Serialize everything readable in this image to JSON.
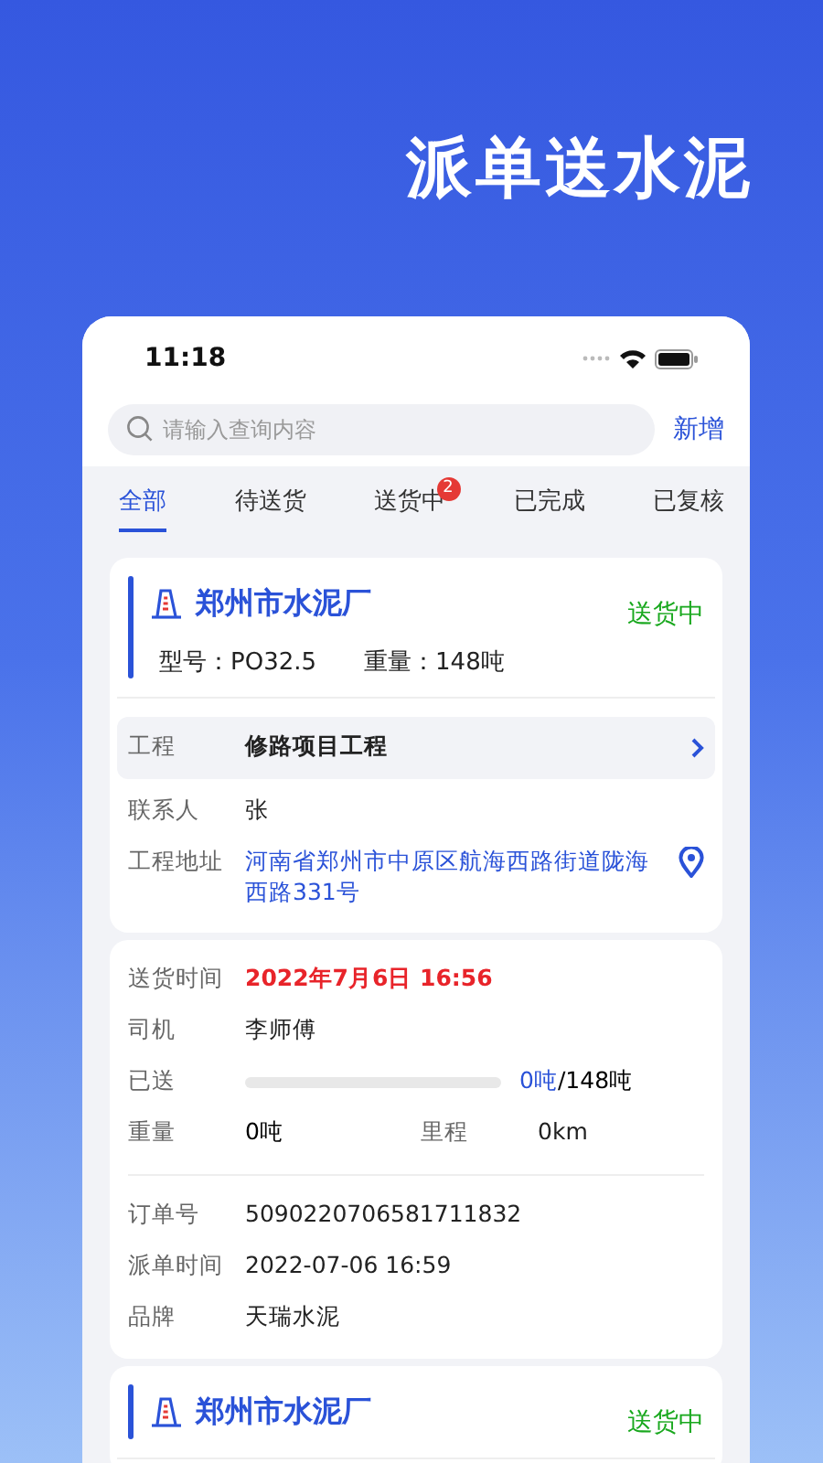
{
  "headline": "派单送水泥",
  "status_bar": {
    "time": "11:18"
  },
  "search": {
    "placeholder": "请输入查询内容",
    "action": "新增"
  },
  "tabs": [
    {
      "label": "全部",
      "selected": true
    },
    {
      "label": "待送货",
      "selected": false
    },
    {
      "label": "送货中",
      "selected": false,
      "badge": "2"
    },
    {
      "label": "已完成",
      "selected": false
    },
    {
      "label": "已复核",
      "selected": false
    }
  ],
  "orders": [
    {
      "factory": "郑州市水泥厂",
      "status": "送货中",
      "model": "型号：PO32.5",
      "weight": "重量：148吨",
      "project_label": "工程",
      "project": "修路项目工程",
      "contact_label": "联系人",
      "contact": "张",
      "address_label": "工程地址",
      "address": "河南省郑州市中原区航海西路街道陇海西路331号",
      "delivery_time_label": "送货时间",
      "delivery_time": "2022年7月6日 16:56",
      "driver_label": "司机",
      "driver": "李师傅",
      "sent_label": "已送",
      "level": 0,
      "sent": "0吨",
      "total": "/148吨",
      "load_label": "重量",
      "load": "0吨",
      "distance_label": "里程",
      "distance": "0km",
      "order_no_label": "订单号",
      "order_no": "5090220706581711832",
      "dispatch_label": "派单时间",
      "dispatch_time": "2022-07-06 16:59",
      "brand_label": "品牌",
      "brand": "天瑞水泥"
    },
    {
      "factory": "郑州市水泥厂",
      "status": "送货中"
    }
  ]
}
